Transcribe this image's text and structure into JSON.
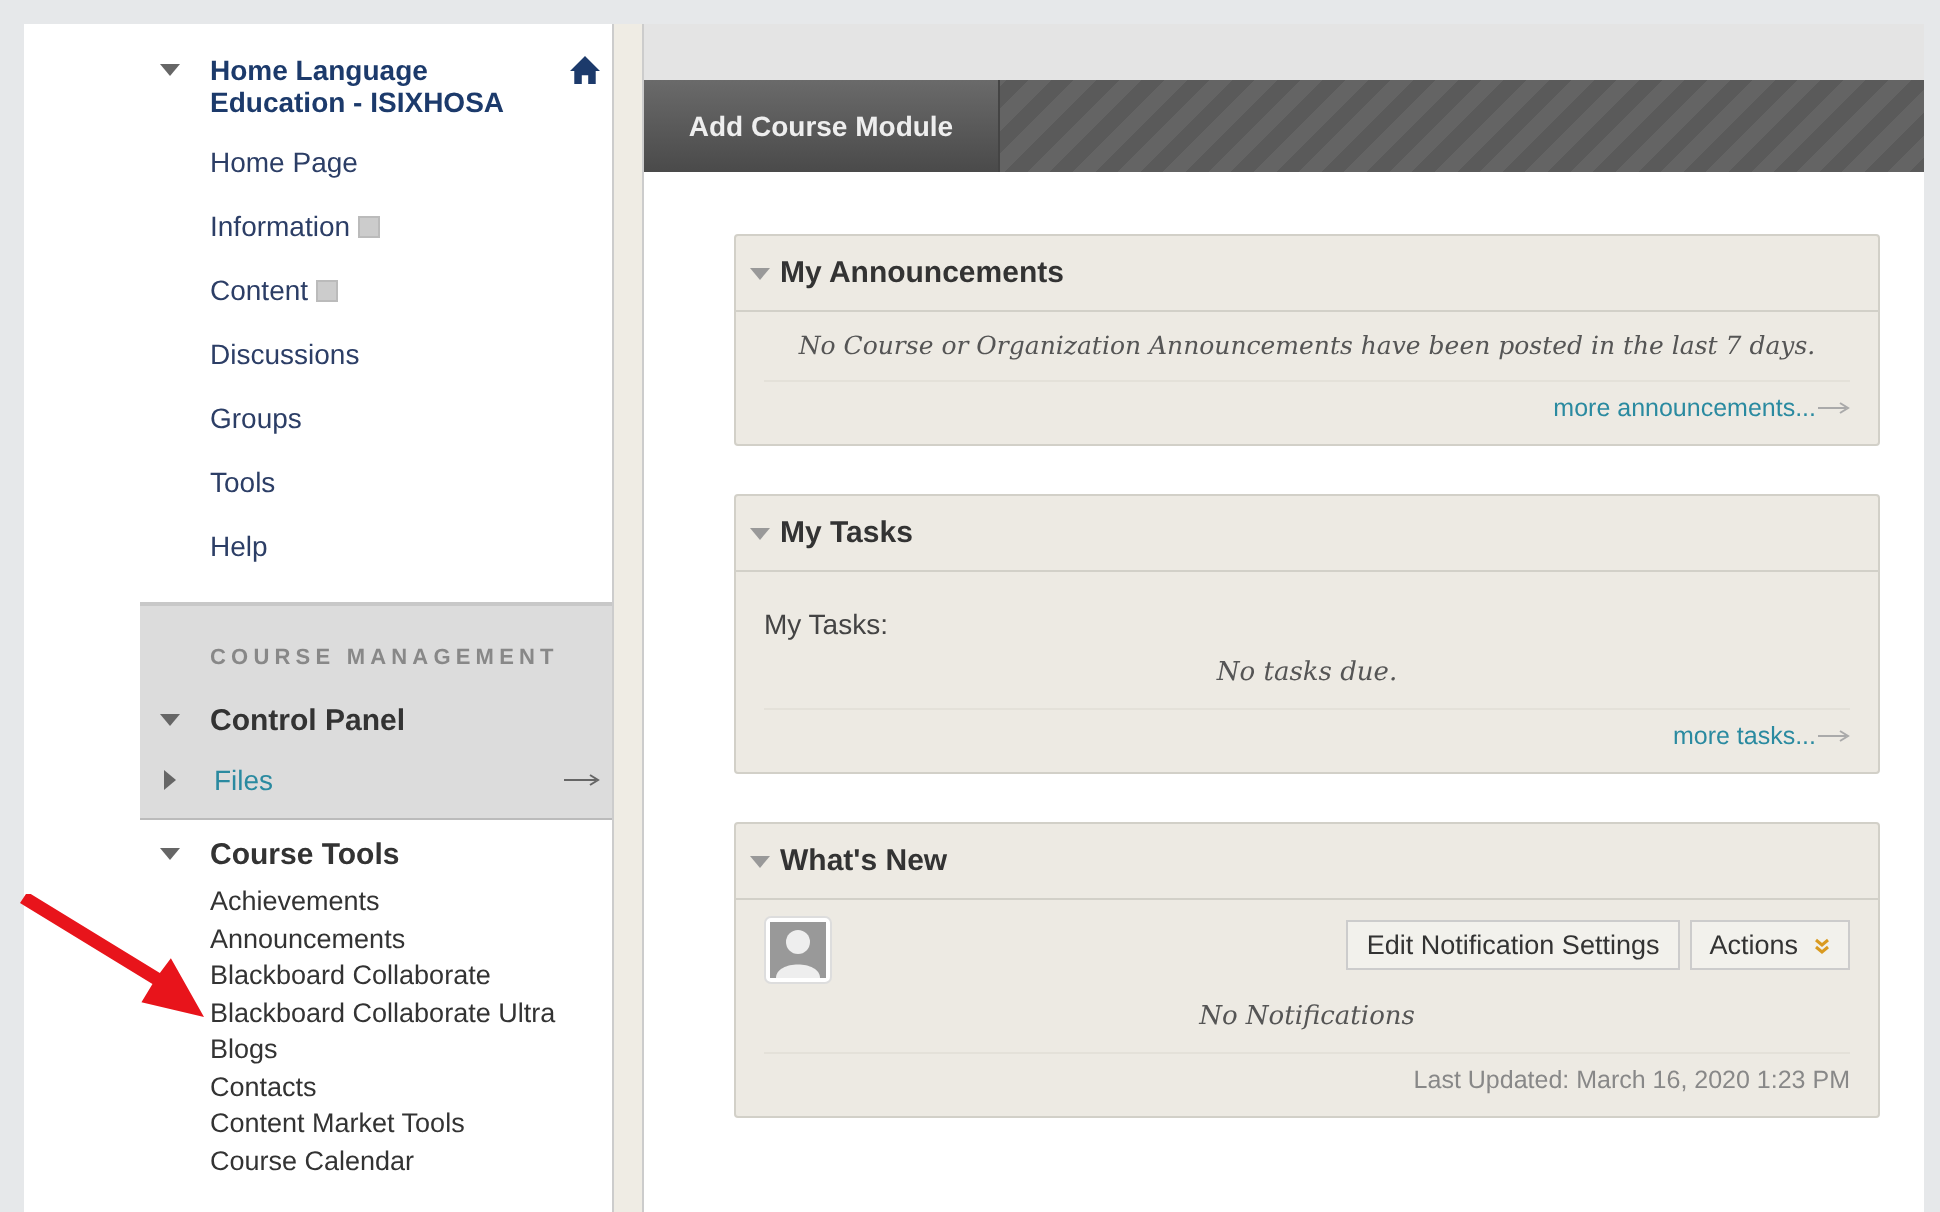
{
  "course_menu": {
    "title": "Home Language Education - ISIXHOSA",
    "expanded": true,
    "items": [
      {
        "label": "Home Page",
        "has_menu": false
      },
      {
        "label": "Information",
        "has_menu": true
      },
      {
        "label": "Content",
        "has_menu": true
      },
      {
        "label": "Discussions",
        "has_menu": false
      },
      {
        "label": "Groups",
        "has_menu": false
      },
      {
        "label": "Tools",
        "has_menu": false
      },
      {
        "label": "Help",
        "has_menu": false
      }
    ]
  },
  "course_management": {
    "heading": "COURSE MANAGEMENT",
    "sections": [
      {
        "label": "Control Panel",
        "expanded": true,
        "kind": "header"
      },
      {
        "label": "Files",
        "expanded": false,
        "kind": "link"
      }
    ]
  },
  "course_tools": {
    "label": "Course Tools",
    "expanded": true,
    "items": [
      "Achievements",
      "Announcements",
      "Blackboard Collaborate",
      "Blackboard Collaborate Ultra",
      "Blogs",
      "Contacts",
      "Content Market Tools",
      "Course Calendar"
    ]
  },
  "toolbar": {
    "button": "Add Course Module"
  },
  "modules": [
    {
      "title": "My Announcements",
      "kind": "announcements",
      "message": "No Course or Organization Announcements have been posted in the last 7 days.",
      "more_link": "more announcements..."
    },
    {
      "title": "My Tasks",
      "kind": "tasks",
      "label": "My Tasks:",
      "message": "No tasks due.",
      "more_link": "more tasks..."
    },
    {
      "title": "What's New",
      "kind": "whats_new",
      "buttons": [
        "Edit Notification Settings",
        "Actions"
      ],
      "message": "No Notifications",
      "updated": "Last Updated: March 16, 2020 1:23 PM"
    }
  ]
}
